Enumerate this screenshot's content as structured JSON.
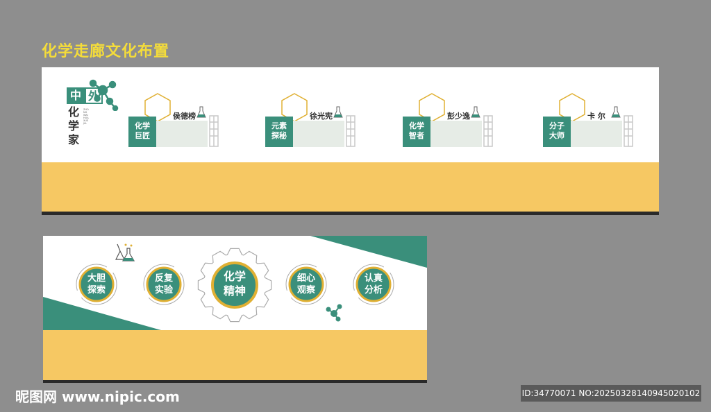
{
  "title": "化学走廊文化布置",
  "top_board": {
    "heading_chars": [
      "中",
      "外"
    ],
    "heading_main": "化学家",
    "heading_pinyin": "ZHONG WAI HUA XUE JIA",
    "cards": [
      {
        "name": "侯德榜",
        "chip": [
          "化学",
          "巨匠"
        ]
      },
      {
        "name": "徐光宪",
        "chip": [
          "元素",
          "探秘"
        ]
      },
      {
        "name": "彭少逸",
        "chip": [
          "化学",
          "智者"
        ]
      },
      {
        "name": "卡 尔",
        "chip": [
          "分子",
          "大师"
        ]
      }
    ]
  },
  "bottom_board": {
    "center": [
      "化学",
      "精神"
    ],
    "circles": [
      [
        "大胆",
        "探索"
      ],
      [
        "反复",
        "实验"
      ],
      [
        "细心",
        "观察"
      ],
      [
        "认真",
        "分析"
      ]
    ]
  },
  "watermark": {
    "left": "昵图网 www.nipic.com",
    "right": "ID:34770071 NO:20250328140945020102"
  },
  "colors": {
    "green": "#3a8f7b",
    "yellow": "#f6c863",
    "gold": "#e0b033",
    "background": "#8e8e8e"
  }
}
